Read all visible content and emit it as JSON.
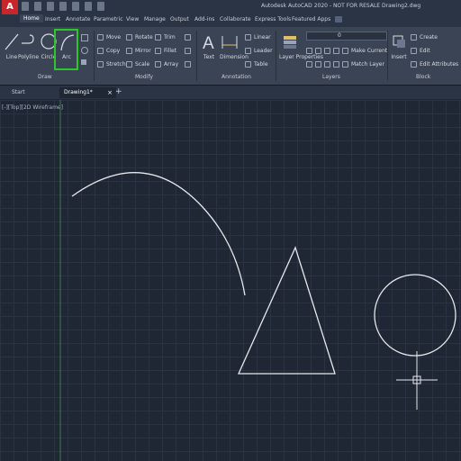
{
  "app": {
    "logo": "A",
    "title": "Autodesk AutoCAD 2020 - NOT FOR RESALE   Drawing2.dwg"
  },
  "ribbon_tabs": [
    "Home",
    "Insert",
    "Annotate",
    "Parametric",
    "View",
    "Manage",
    "Output",
    "Add-ins",
    "Collaborate",
    "Express Tools",
    "Featured Apps"
  ],
  "draw_panel": {
    "title": "Draw",
    "line": "Line",
    "polyline": "Polyline",
    "circle": "Circle",
    "arc": "Arc"
  },
  "modify_panel": {
    "title": "Modify",
    "move": "Move",
    "rotate": "Rotate",
    "trim": "Trim",
    "copy": "Copy",
    "mirror": "Mirror",
    "fillet": "Fillet",
    "stretch": "Stretch",
    "scale": "Scale",
    "array": "Array"
  },
  "annotation_panel": {
    "title": "Annotation",
    "text": "Text",
    "dimension": "Dimension",
    "linear": "Linear",
    "leader": "Leader",
    "table": "Table"
  },
  "layers_panel": {
    "title": "Layers",
    "layer_properties": "Layer Properties",
    "current_layer": "0",
    "make_current": "Make Current",
    "match_layer": "Match Layer"
  },
  "block_panel": {
    "title": "Block",
    "insert": "Insert",
    "create": "Create",
    "edit": "Edit",
    "edit_attributes": "Edit Attributes"
  },
  "doc_tabs": {
    "start": "Start",
    "drawing": "Drawing1*",
    "close": "×",
    "add": "+"
  },
  "viewport": {
    "label": "[-][Top][2D Wireframe]"
  },
  "colors": {
    "canvas": "#1f2735",
    "grid": "#2a3344",
    "highlight": "#2dc62d",
    "accent": "#c8262b"
  }
}
